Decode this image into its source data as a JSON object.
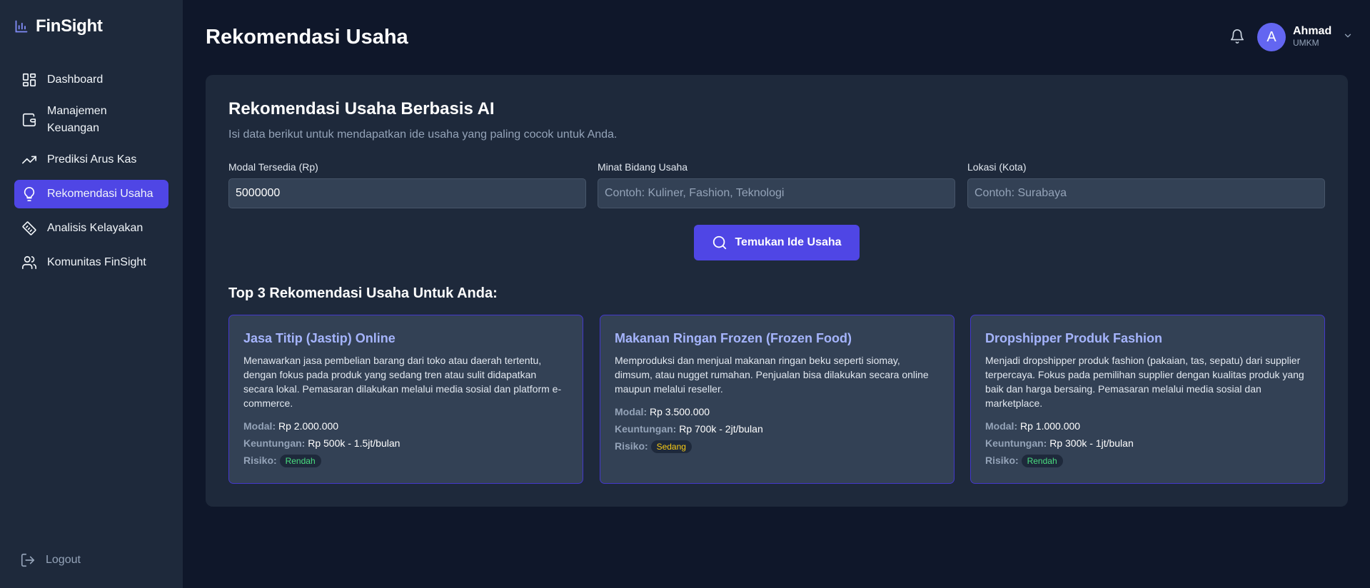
{
  "brand": {
    "name": "FinSight",
    "icon": "bar-chart-icon"
  },
  "sidebar": {
    "items": [
      {
        "label": "Dashboard",
        "icon": "dashboard-grid-icon"
      },
      {
        "label": "Manajemen Keuangan",
        "icon": "wallet-icon"
      },
      {
        "label": "Prediksi Arus Kas",
        "icon": "trending-up-icon"
      },
      {
        "label": "Rekomendasi Usaha",
        "icon": "lightbulb-icon",
        "active": true
      },
      {
        "label": "Analisis Kelayakan",
        "icon": "ruler-icon"
      },
      {
        "label": "Komunitas FinSight",
        "icon": "users-icon"
      }
    ],
    "logout": "Logout"
  },
  "header": {
    "title": "Rekomendasi Usaha",
    "user": {
      "initial": "A",
      "name": "Ahmad",
      "role": "UMKM"
    }
  },
  "form": {
    "title": "Rekomendasi Usaha Berbasis AI",
    "subtitle": "Isi data berikut untuk mendapatkan ide usaha yang paling cocok untuk Anda.",
    "modal": {
      "label": "Modal Tersedia (Rp)",
      "value": "5000000",
      "placeholder": ""
    },
    "minat": {
      "label": "Minat Bidang Usaha",
      "value": "",
      "placeholder": "Contoh: Kuliner, Fashion, Teknologi"
    },
    "lokasi": {
      "label": "Lokasi (Kota)",
      "value": "",
      "placeholder": "Contoh: Surabaya"
    },
    "submit": "Temukan Ide Usaha"
  },
  "results": {
    "title": "Top 3 Rekomendasi Usaha Untuk Anda:",
    "labels": {
      "modal": "Modal:",
      "keuntungan": "Keuntungan:",
      "risiko": "Risiko:"
    },
    "cards": [
      {
        "title": "Jasa Titip (Jastip) Online",
        "description": "Menawarkan jasa pembelian barang dari toko atau daerah tertentu, dengan fokus pada produk yang sedang tren atau sulit didapatkan secara lokal. Pemasaran dilakukan melalui media sosial dan platform e-commerce.",
        "modal": "Rp 2.000.000",
        "keuntungan": "Rp 500k - 1.5jt/bulan",
        "risiko": "Rendah",
        "risk_color": "#4ade80"
      },
      {
        "title": "Makanan Ringan Frozen (Frozen Food)",
        "description": "Memproduksi dan menjual makanan ringan beku seperti siomay, dimsum, atau nugget rumahan. Penjualan bisa dilakukan secara online maupun melalui reseller.",
        "modal": "Rp 3.500.000",
        "keuntungan": "Rp 700k - 2jt/bulan",
        "risiko": "Sedang",
        "risk_color": "#facc15"
      },
      {
        "title": "Dropshipper Produk Fashion",
        "description": "Menjadi dropshipper produk fashion (pakaian, tas, sepatu) dari supplier terpercaya. Fokus pada pemilihan supplier dengan kualitas produk yang baik dan harga bersaing. Pemasaran melalui media sosial dan marketplace.",
        "modal": "Rp 1.000.000",
        "keuntungan": "Rp 300k - 1jt/bulan",
        "risiko": "Rendah",
        "risk_color": "#4ade80"
      }
    ]
  },
  "colors": {
    "accent": "#4f46e5",
    "background": "#0f172a",
    "surface": "#1e293b"
  }
}
